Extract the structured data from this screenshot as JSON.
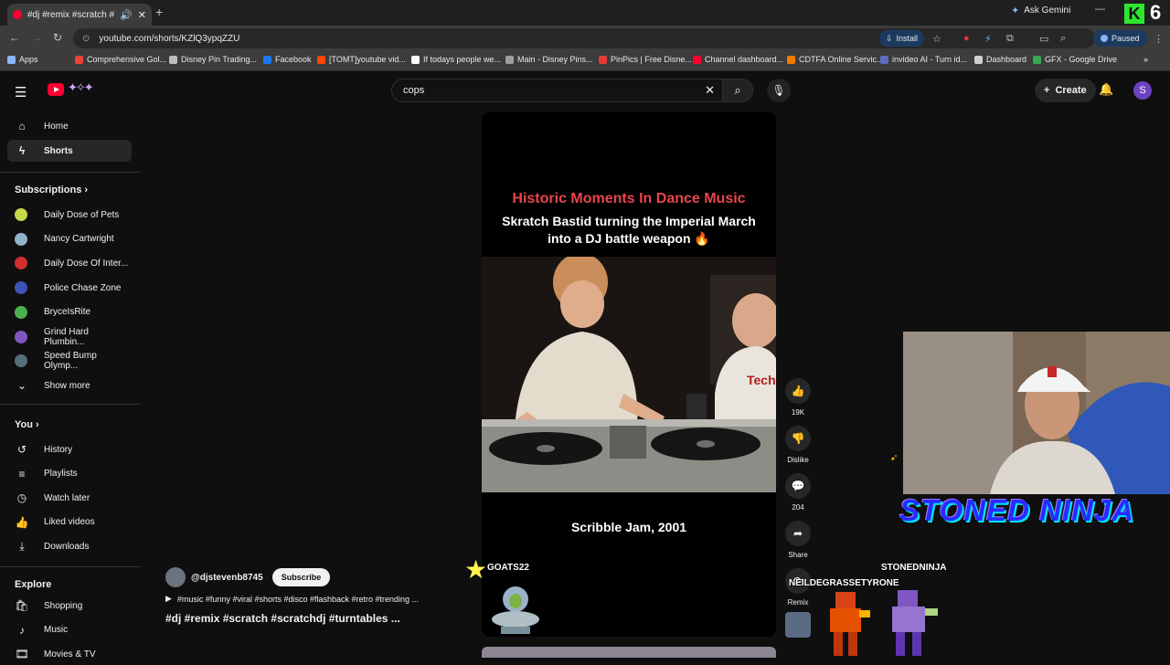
{
  "browser": {
    "tab_title": "#dj #remix #scratch #scratc",
    "url": "youtube.com/shorts/KZlQ3ypqZZU",
    "install_label": "Install",
    "gemini_label": "Ask Gemini",
    "profile_status": "Paused",
    "corner_number": "6"
  },
  "bookmarks": [
    {
      "label": "Apps",
      "color": "#8ab4f8"
    },
    {
      "label": "Comprehensive Gol...",
      "color": "#ea4335"
    },
    {
      "label": "Disney Pin Trading...",
      "color": "#bdbdbd"
    },
    {
      "label": "Facebook",
      "color": "#1877f2"
    },
    {
      "label": "[TOMT]youtube vid...",
      "color": "#ff4500"
    },
    {
      "label": "If todays people we...",
      "color": "#ffffff"
    },
    {
      "label": "Main - Disney Pins...",
      "color": "#9e9e9e"
    },
    {
      "label": "PinPics | Free Disne...",
      "color": "#e53935"
    },
    {
      "label": "Channel dashboard...",
      "color": "#ff0033"
    },
    {
      "label": "CDTFA Online Servic...",
      "color": "#f57c00"
    },
    {
      "label": "invideo AI - Turn id...",
      "color": "#5c6bc0"
    },
    {
      "label": "Dashboard",
      "color": "#cfcfcf"
    },
    {
      "label": "GFX - Google Drive",
      "color": "#34a853"
    }
  ],
  "header": {
    "search_value": "cops",
    "create_label": "Create",
    "avatar_letter": "S"
  },
  "sidebar": {
    "home": "Home",
    "shorts": "Shorts",
    "subscriptions_title": "Subscriptions",
    "subscriptions": [
      {
        "label": "Daily Dose of Pets",
        "color": "#c6d94a"
      },
      {
        "label": "Nancy Cartwright",
        "color": "#8fb3c9"
      },
      {
        "label": "Daily Dose Of Inter...",
        "color": "#d32f2f"
      },
      {
        "label": "Police Chase Zone",
        "color": "#3f51b5"
      },
      {
        "label": "BryceIsRite",
        "color": "#4caf50"
      },
      {
        "label": "Grind Hard Plumbin...",
        "color": "#7e57c2"
      },
      {
        "label": "Speed Bump Olymp...",
        "color": "#546e7a"
      }
    ],
    "show_more": "Show more",
    "you_title": "You",
    "you_items": [
      "History",
      "Playlists",
      "Watch later",
      "Liked videos",
      "Downloads"
    ],
    "explore_title": "Explore",
    "explore_items": [
      "Shopping",
      "Music",
      "Movies & TV"
    ]
  },
  "short": {
    "headline": "Historic Moments In Dance Music",
    "subheadline": "Skratch Bastid turning the Imperial March into a DJ battle weapon 🔥",
    "caption": "Scribble Jam, 2001",
    "channel": "@djstevenb8745",
    "subscribe_label": "Subscribe",
    "music_line": "#music #funny #viral #shorts #disco #flashback #retro #trending ...",
    "title": "#dj #remix #scratch #scratchdj #turntables ..."
  },
  "actions": {
    "likes": "19K",
    "dislike": "Dislike",
    "comments": "204",
    "share": "Share",
    "remix": "Remix"
  },
  "overlays": {
    "stream_name": "STONED NINJA",
    "alert_left": "GOATS22",
    "alert_right": "STONEDNINJA",
    "alert_mid": "NEILDEGRASSETYRONE"
  }
}
